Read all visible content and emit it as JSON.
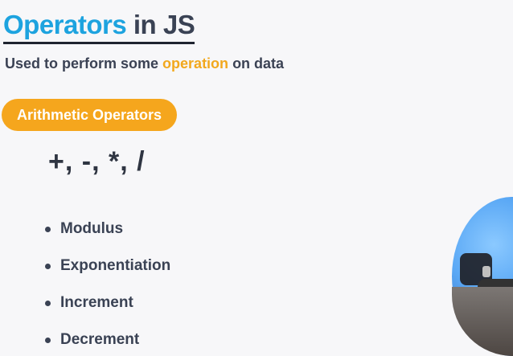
{
  "slide": {
    "title": {
      "accent_text": "Operators",
      "rest_text": " in JS",
      "accent_color": "#1DA3DF"
    },
    "subtitle": {
      "before": "Used to perform some ",
      "highlight": "operation",
      "after": " on data",
      "highlight_color": "#F2A81D"
    },
    "section_pill": {
      "label": "Arithmetic Operators",
      "color": "#F5A61D"
    },
    "operators_text": "+, -, *, /",
    "bullets": [
      {
        "label": "Modulus"
      },
      {
        "label": "Exponentiation"
      },
      {
        "label": "Increment"
      },
      {
        "label": "Decrement"
      }
    ]
  }
}
